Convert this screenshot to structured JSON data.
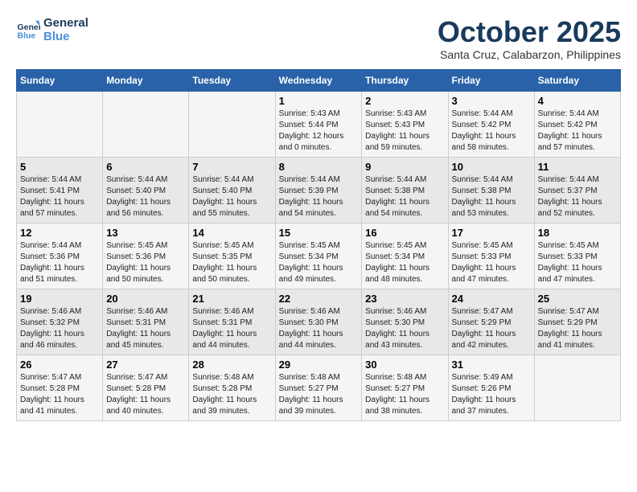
{
  "logo": {
    "line1": "General",
    "line2": "Blue"
  },
  "title": "October 2025",
  "subtitle": "Santa Cruz, Calabarzon, Philippines",
  "days_of_week": [
    "Sunday",
    "Monday",
    "Tuesday",
    "Wednesday",
    "Thursday",
    "Friday",
    "Saturday"
  ],
  "weeks": [
    [
      {
        "day": "",
        "info": ""
      },
      {
        "day": "",
        "info": ""
      },
      {
        "day": "",
        "info": ""
      },
      {
        "day": "1",
        "info": "Sunrise: 5:43 AM\nSunset: 5:44 PM\nDaylight: 12 hours\nand 0 minutes."
      },
      {
        "day": "2",
        "info": "Sunrise: 5:43 AM\nSunset: 5:43 PM\nDaylight: 11 hours\nand 59 minutes."
      },
      {
        "day": "3",
        "info": "Sunrise: 5:44 AM\nSunset: 5:42 PM\nDaylight: 11 hours\nand 58 minutes."
      },
      {
        "day": "4",
        "info": "Sunrise: 5:44 AM\nSunset: 5:42 PM\nDaylight: 11 hours\nand 57 minutes."
      }
    ],
    [
      {
        "day": "5",
        "info": "Sunrise: 5:44 AM\nSunset: 5:41 PM\nDaylight: 11 hours\nand 57 minutes."
      },
      {
        "day": "6",
        "info": "Sunrise: 5:44 AM\nSunset: 5:40 PM\nDaylight: 11 hours\nand 56 minutes."
      },
      {
        "day": "7",
        "info": "Sunrise: 5:44 AM\nSunset: 5:40 PM\nDaylight: 11 hours\nand 55 minutes."
      },
      {
        "day": "8",
        "info": "Sunrise: 5:44 AM\nSunset: 5:39 PM\nDaylight: 11 hours\nand 54 minutes."
      },
      {
        "day": "9",
        "info": "Sunrise: 5:44 AM\nSunset: 5:38 PM\nDaylight: 11 hours\nand 54 minutes."
      },
      {
        "day": "10",
        "info": "Sunrise: 5:44 AM\nSunset: 5:38 PM\nDaylight: 11 hours\nand 53 minutes."
      },
      {
        "day": "11",
        "info": "Sunrise: 5:44 AM\nSunset: 5:37 PM\nDaylight: 11 hours\nand 52 minutes."
      }
    ],
    [
      {
        "day": "12",
        "info": "Sunrise: 5:44 AM\nSunset: 5:36 PM\nDaylight: 11 hours\nand 51 minutes."
      },
      {
        "day": "13",
        "info": "Sunrise: 5:45 AM\nSunset: 5:36 PM\nDaylight: 11 hours\nand 50 minutes."
      },
      {
        "day": "14",
        "info": "Sunrise: 5:45 AM\nSunset: 5:35 PM\nDaylight: 11 hours\nand 50 minutes."
      },
      {
        "day": "15",
        "info": "Sunrise: 5:45 AM\nSunset: 5:34 PM\nDaylight: 11 hours\nand 49 minutes."
      },
      {
        "day": "16",
        "info": "Sunrise: 5:45 AM\nSunset: 5:34 PM\nDaylight: 11 hours\nand 48 minutes."
      },
      {
        "day": "17",
        "info": "Sunrise: 5:45 AM\nSunset: 5:33 PM\nDaylight: 11 hours\nand 47 minutes."
      },
      {
        "day": "18",
        "info": "Sunrise: 5:45 AM\nSunset: 5:33 PM\nDaylight: 11 hours\nand 47 minutes."
      }
    ],
    [
      {
        "day": "19",
        "info": "Sunrise: 5:46 AM\nSunset: 5:32 PM\nDaylight: 11 hours\nand 46 minutes."
      },
      {
        "day": "20",
        "info": "Sunrise: 5:46 AM\nSunset: 5:31 PM\nDaylight: 11 hours\nand 45 minutes."
      },
      {
        "day": "21",
        "info": "Sunrise: 5:46 AM\nSunset: 5:31 PM\nDaylight: 11 hours\nand 44 minutes."
      },
      {
        "day": "22",
        "info": "Sunrise: 5:46 AM\nSunset: 5:30 PM\nDaylight: 11 hours\nand 44 minutes."
      },
      {
        "day": "23",
        "info": "Sunrise: 5:46 AM\nSunset: 5:30 PM\nDaylight: 11 hours\nand 43 minutes."
      },
      {
        "day": "24",
        "info": "Sunrise: 5:47 AM\nSunset: 5:29 PM\nDaylight: 11 hours\nand 42 minutes."
      },
      {
        "day": "25",
        "info": "Sunrise: 5:47 AM\nSunset: 5:29 PM\nDaylight: 11 hours\nand 41 minutes."
      }
    ],
    [
      {
        "day": "26",
        "info": "Sunrise: 5:47 AM\nSunset: 5:28 PM\nDaylight: 11 hours\nand 41 minutes."
      },
      {
        "day": "27",
        "info": "Sunrise: 5:47 AM\nSunset: 5:28 PM\nDaylight: 11 hours\nand 40 minutes."
      },
      {
        "day": "28",
        "info": "Sunrise: 5:48 AM\nSunset: 5:28 PM\nDaylight: 11 hours\nand 39 minutes."
      },
      {
        "day": "29",
        "info": "Sunrise: 5:48 AM\nSunset: 5:27 PM\nDaylight: 11 hours\nand 39 minutes."
      },
      {
        "day": "30",
        "info": "Sunrise: 5:48 AM\nSunset: 5:27 PM\nDaylight: 11 hours\nand 38 minutes."
      },
      {
        "day": "31",
        "info": "Sunrise: 5:49 AM\nSunset: 5:26 PM\nDaylight: 11 hours\nand 37 minutes."
      },
      {
        "day": "",
        "info": ""
      }
    ]
  ]
}
